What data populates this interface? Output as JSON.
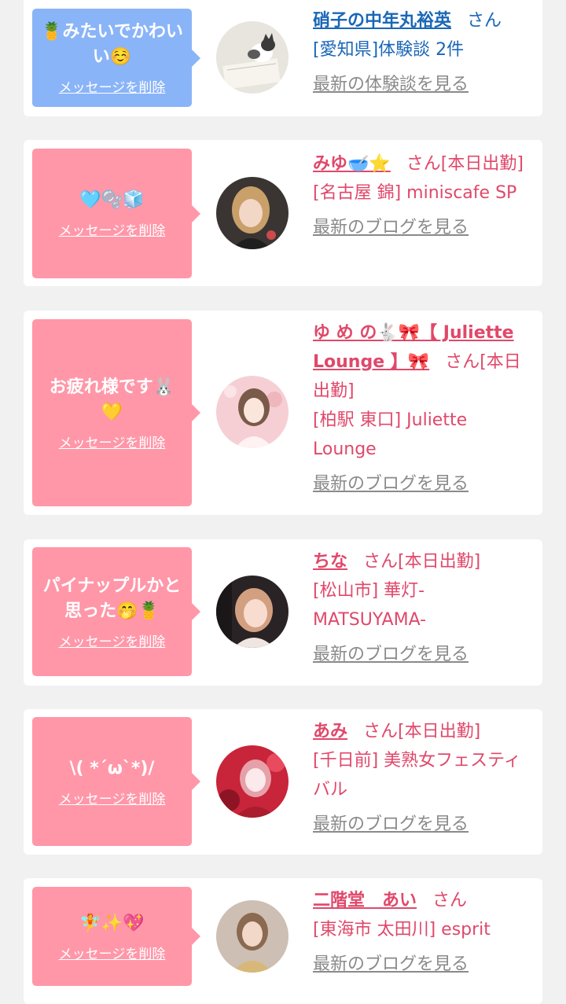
{
  "delete_label": "メッセージを削除",
  "colors": {
    "pink": "#ff97a9",
    "blue": "#8ab4f8",
    "pink_text": "#e0486a",
    "blue_text": "#1a67b6",
    "gray_link": "#8a8a8a"
  },
  "cards": [
    {
      "theme": "blue",
      "message": "🍍みたいでかわいい☺️",
      "name": "硝子の中年丸裕英",
      "suffix": "さん",
      "location": "[愛知県]体験談 2件",
      "latest": "最新の体験談を見る",
      "avatar_icon": "cat-notebook-photo"
    },
    {
      "theme": "pink",
      "message": "🩵🫧🧊",
      "name": "みゆ🥣⭐️",
      "suffix": "さん[本日出勤]",
      "location": "[名古屋 錦] miniscafe SP",
      "latest": "最新のブログを見る",
      "avatar_icon": "girl-photo"
    },
    {
      "theme": "pink",
      "message": "お疲れ様です🐰💛",
      "name": "ゆ め の🐇🎀【 Juliette Lounge 】🎀",
      "suffix": "さん[本日出勤]",
      "location": "[柏駅 東口] Juliette Lounge",
      "latest": "最新のブログを見る",
      "avatar_icon": "girl-photo"
    },
    {
      "theme": "pink",
      "message": "パイナップルかと思った🤭🍍",
      "name": "ちな",
      "suffix": "さん[本日出勤]",
      "location": "[松山市] 華灯-MATSUYAMA-",
      "latest": "最新のブログを見る",
      "avatar_icon": "girl-photo"
    },
    {
      "theme": "pink",
      "message": "\\( *´ω`*)/",
      "name": "あみ",
      "suffix": "さん[本日出勤]",
      "location": "[千日前] 美熟女フェスティバル",
      "latest": "最新のブログを見る",
      "avatar_icon": "girl-photo"
    },
    {
      "theme": "pink",
      "message": "🧚✨💖",
      "name": "二階堂　あい",
      "suffix": "さん",
      "location": "[東海市 太田川] esprit",
      "latest": "最新のブログを見る",
      "avatar_icon": "girl-photo"
    }
  ]
}
